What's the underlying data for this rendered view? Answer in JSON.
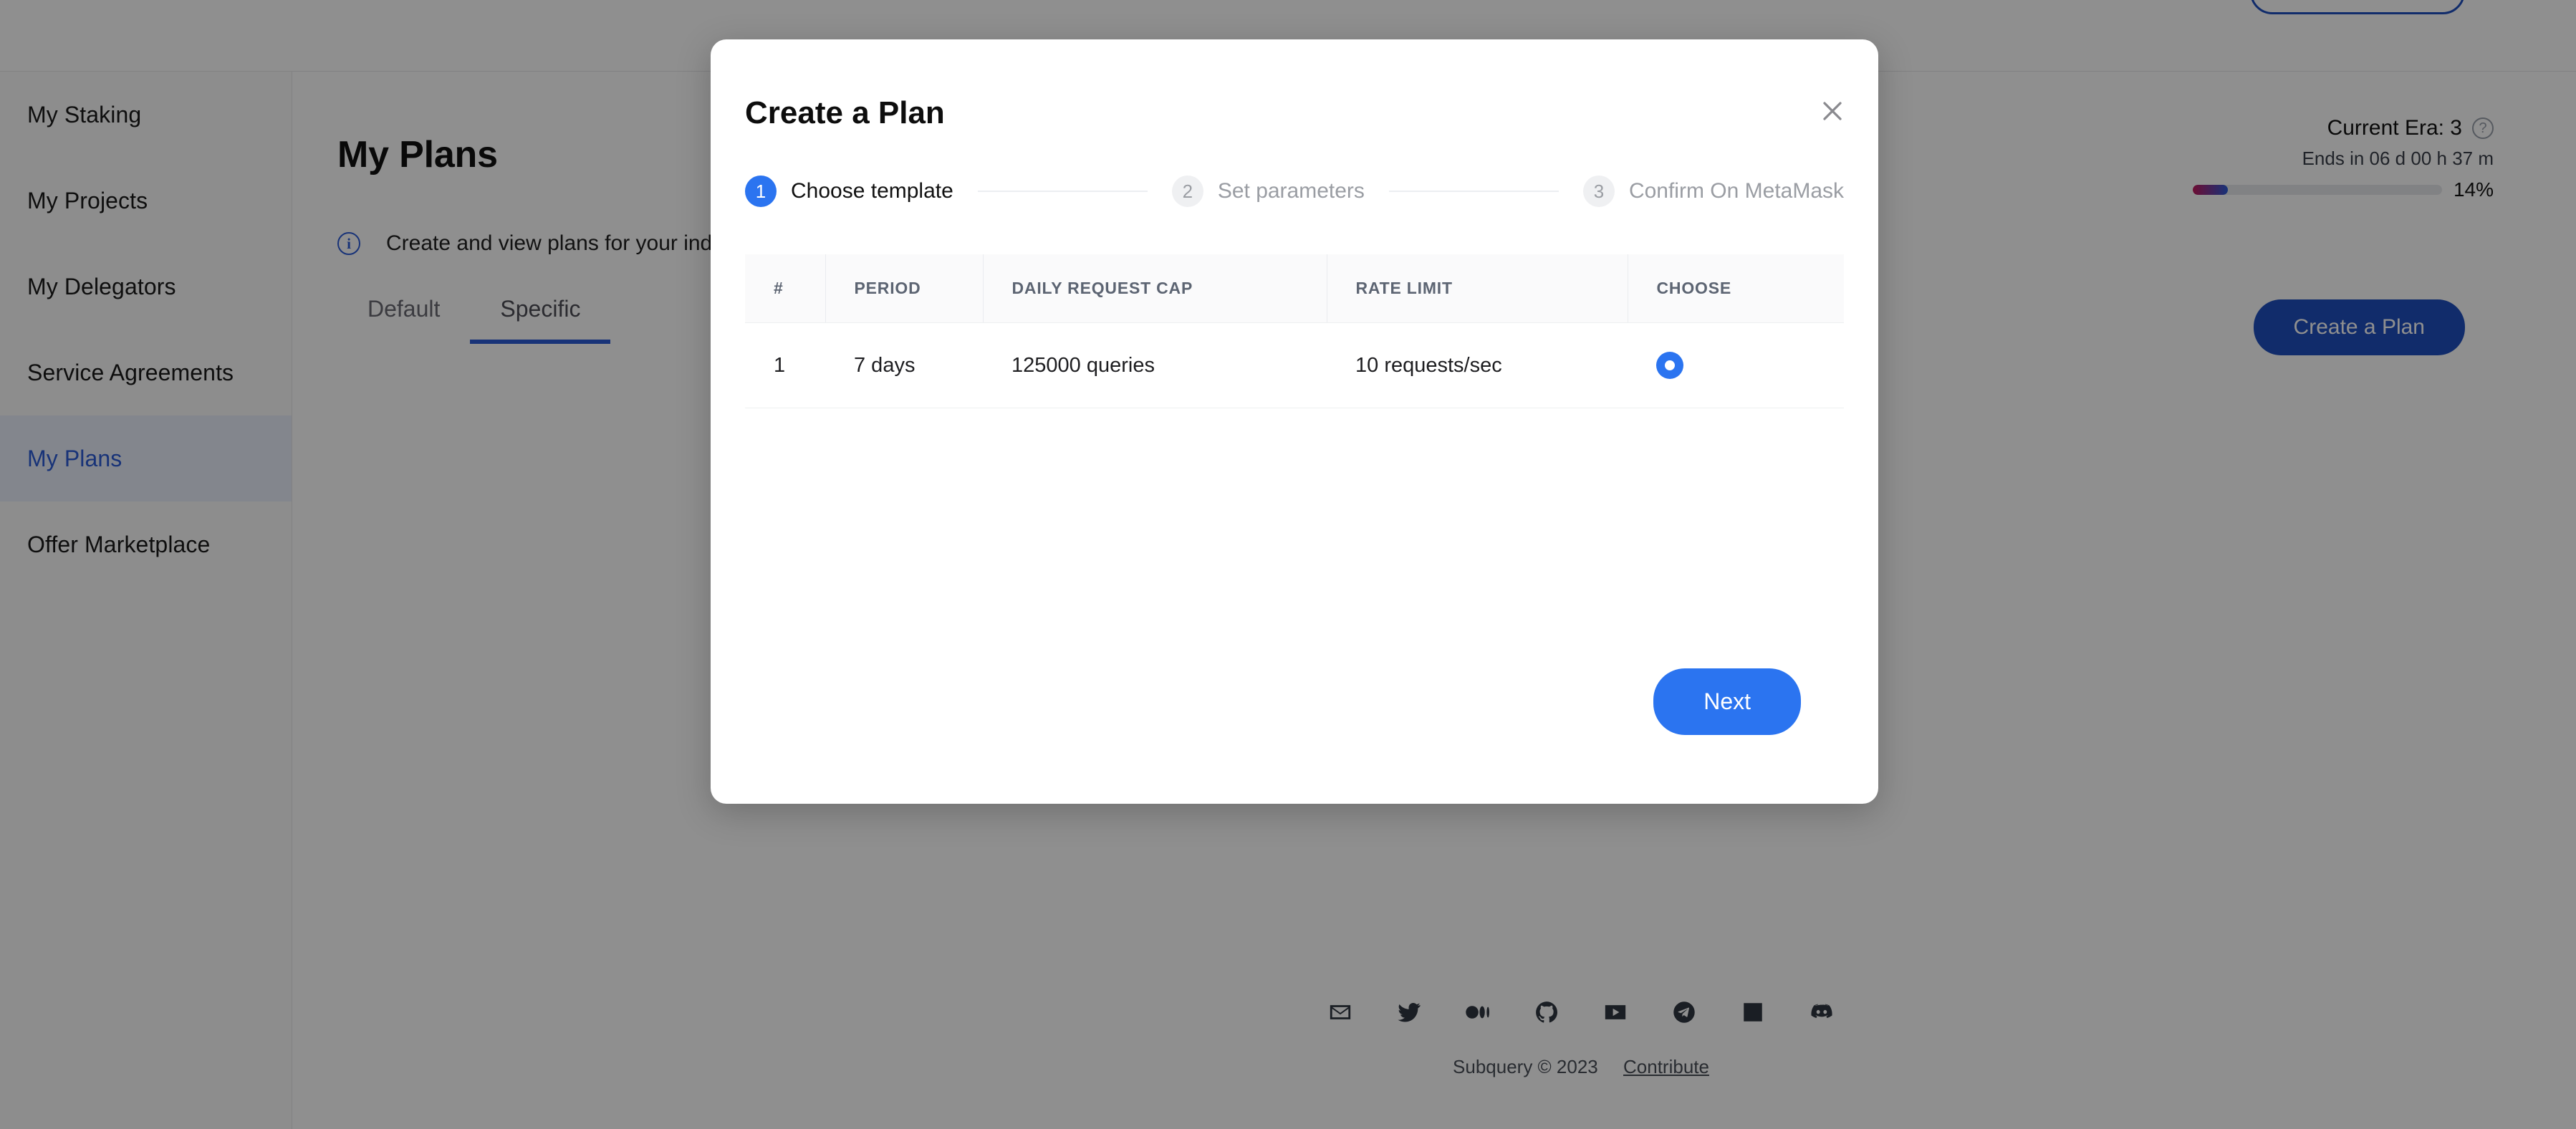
{
  "page": {
    "title": "My Plans",
    "info_text": "Create and view plans for your indexi",
    "tabs": [
      {
        "label": "Default",
        "active": false
      },
      {
        "label": "Specific",
        "active": true
      }
    ],
    "create_plan_button": "Create a Plan"
  },
  "sidebar": {
    "items": [
      {
        "label": "My Staking",
        "active": false
      },
      {
        "label": "My Projects",
        "active": false
      },
      {
        "label": "My Delegators",
        "active": false
      },
      {
        "label": "Service Agreements",
        "active": false
      },
      {
        "label": "My Plans",
        "active": true
      },
      {
        "label": "Offer Marketplace",
        "active": false
      }
    ]
  },
  "era": {
    "title": "Current Era: 3",
    "ends_in": "Ends in 06 d 00 h 37 m",
    "percent_label": "14%",
    "percent_value": 14,
    "gradient_from": "#c2185b",
    "gradient_to": "#2b5bd7"
  },
  "modal": {
    "title": "Create a Plan",
    "close_icon": "close-icon",
    "steps": [
      {
        "number": "1",
        "label": "Choose template",
        "current": true
      },
      {
        "number": "2",
        "label": "Set parameters",
        "current": false
      },
      {
        "number": "3",
        "label": "Confirm On MetaMask",
        "current": false
      }
    ],
    "table": {
      "columns": [
        "#",
        "PERIOD",
        "DAILY REQUEST CAP",
        "RATE LIMIT",
        "CHOOSE"
      ],
      "rows": [
        {
          "index": "1",
          "period": "7 days",
          "daily_request_cap": "125000 queries",
          "rate_limit": "10 requests/sec",
          "chosen": true
        }
      ]
    },
    "next_button": "Next"
  },
  "footer": {
    "social_icons": [
      "email-icon",
      "twitter-icon",
      "medium-icon",
      "github-icon",
      "youtube-icon",
      "telegram-icon",
      "linkedin-icon",
      "discord-icon"
    ],
    "copyright": "Subquery © 2023",
    "contribute_link": "Contribute"
  },
  "colors": {
    "accent_blue": "#2b74f0",
    "brand_blue": "#1f4fbf",
    "sidebar_active_bg": "#e9effb"
  }
}
